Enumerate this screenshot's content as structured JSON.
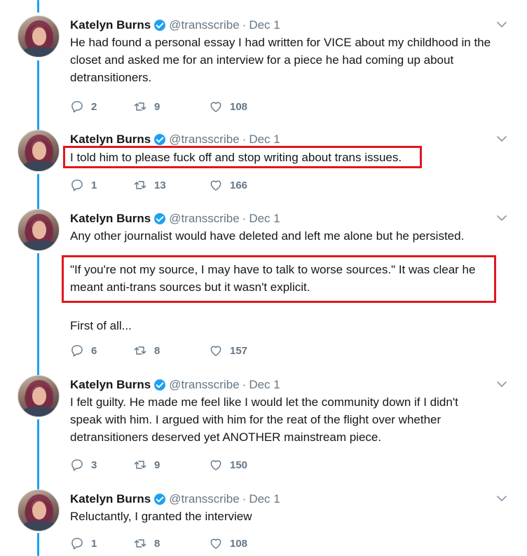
{
  "colors": {
    "accent": "#1da1f2",
    "highlight_box": "#e0181f",
    "muted": "#657786",
    "text": "#14171a"
  },
  "tweets": [
    {
      "name": "Katelyn Burns",
      "handle": "@transscribe",
      "date": "Dec 1",
      "lines": [
        "He had found a personal essay I had written for VICE about my childhood in the",
        "closet and asked me for an interview for a piece he had coming up about",
        "detransitioners."
      ],
      "replies": "2",
      "retweets": "9",
      "likes": "108"
    },
    {
      "name": "Katelyn Burns",
      "handle": "@transscribe",
      "date": "Dec 1",
      "lines": [
        "I told him to please fuck off and stop writing about trans issues."
      ],
      "replies": "1",
      "retweets": "13",
      "likes": "166"
    },
    {
      "name": "Katelyn Burns",
      "handle": "@transscribe",
      "date": "Dec 1",
      "lines": [
        "Any other journalist would have deleted and left me alone but he persisted."
      ],
      "quote_lines": [
        "\"If you're not my source, I may have to talk to worse sources.\" It was clear he",
        "meant anti-trans sources but it wasn't explicit."
      ],
      "after": "First of all...",
      "replies": "6",
      "retweets": "8",
      "likes": "157"
    },
    {
      "name": "Katelyn Burns",
      "handle": "@transscribe",
      "date": "Dec 1",
      "lines": [
        "I felt guilty. He made me feel like I would let the community down if I didn't",
        "speak with him. I argued with him for the reat of the flight over whether",
        "detransitioners deserved yet ANOTHER mainstream piece."
      ],
      "replies": "3",
      "retweets": "9",
      "likes": "150"
    },
    {
      "name": "Katelyn Burns",
      "handle": "@transscribe",
      "date": "Dec 1",
      "lines": [
        "Reluctantly, I granted the interview"
      ],
      "replies": "1",
      "retweets": "8",
      "likes": "108"
    }
  ]
}
